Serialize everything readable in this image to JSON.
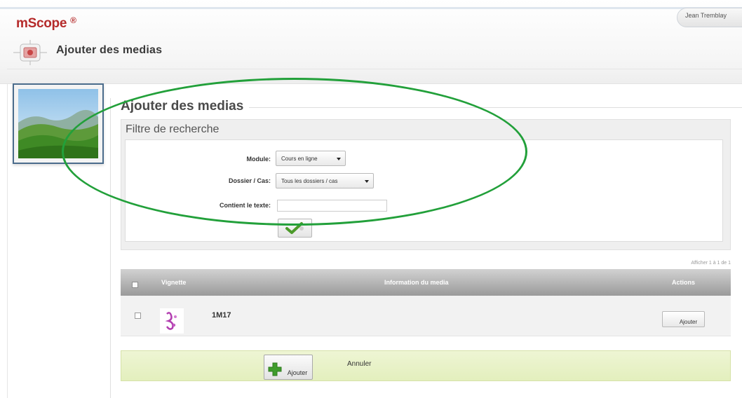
{
  "app": {
    "brand": "mScope",
    "brand_mark": "®",
    "user": "Jean Tremblay"
  },
  "header": {
    "page_title": "Ajouter des medias"
  },
  "section": {
    "title": "Ajouter des medias"
  },
  "filter": {
    "title": "Filtre de recherche",
    "module_label": "Module:",
    "module_value": "Cours en ligne",
    "folder_label": "Dossier / Cas:",
    "folder_value": "Tous les dossiers / cas",
    "text_label": "Contient le texte:",
    "text_value": ""
  },
  "results": {
    "count_text": "Afficher 1 à 1 de 1",
    "columns": {
      "thumbnail": "Vignette",
      "info": "Information du media",
      "actions": "Actions"
    },
    "rows": [
      {
        "title": "1M17",
        "action_label": "Ajouter"
      }
    ]
  },
  "footer": {
    "add_label": "Ajouter",
    "cancel_label": "Annuler"
  },
  "colors": {
    "brand": "#b52a2a",
    "highlight": "#22a03a",
    "footer_bar": "#e6f0c4",
    "grid_header": "#a8a8a8"
  },
  "icons": {
    "page": "media-frame-icon",
    "search": "checkmark-icon",
    "add": "green-plus-icon"
  }
}
